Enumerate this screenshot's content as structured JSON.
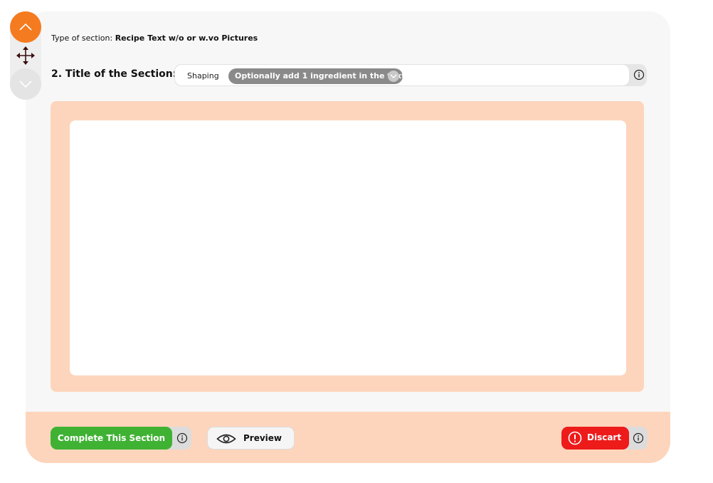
{
  "section": {
    "type_prefix": "Type of section:",
    "type_value": "Recipe Text w/o or w.vo Pictures"
  },
  "title_row": {
    "label": "2. Title of the Section:",
    "shaping_label": "Shaping",
    "ingredient_option": "Optionally add 1 ingredient in the text"
  },
  "text_area": {
    "value": ""
  },
  "footer": {
    "complete_label": "Complete This Section",
    "preview_label": "Preview",
    "discard_label": "Discart"
  },
  "colors": {
    "accent_orange": "#f47b20",
    "peach": "#fdd5bc",
    "complete_green": "#3fb233",
    "discard_red": "#ee1b1b",
    "pill_gray": "#8a8a8a"
  },
  "icons": [
    "chevron-up-icon",
    "move-icon",
    "chevron-down-icon",
    "info-icon",
    "eye-icon",
    "warning-icon"
  ]
}
